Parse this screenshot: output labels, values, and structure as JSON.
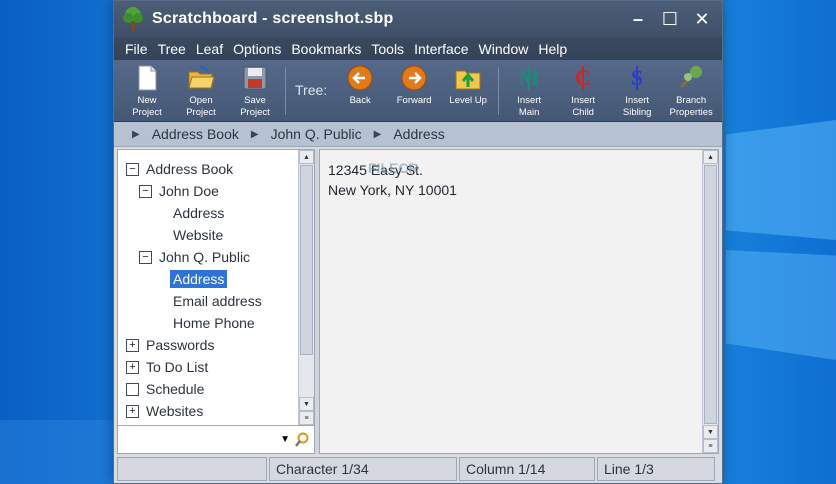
{
  "window": {
    "title": "Scratchboard - screenshot.sbp",
    "controls": {
      "minimize": "–",
      "maximize": "☐",
      "close": "✕"
    }
  },
  "menu": [
    "File",
    "Tree",
    "Leaf",
    "Options",
    "Bookmarks",
    "Tools",
    "Interface",
    "Window",
    "Help"
  ],
  "toolbar": {
    "new_project": "New\nProject",
    "open_project": "Open\nProject",
    "save_project": "Save\nProject",
    "tree_label": "Tree:",
    "back": "Back",
    "forward": "Forward",
    "level_up": "Level Up",
    "insert_main": "Insert\nMain",
    "insert_child": "Insert\nChild",
    "insert_sibling": "Insert\nSibling",
    "branch_properties": "Branch\nProperties"
  },
  "breadcrumb": [
    "Address Book",
    "John Q. Public",
    "Address"
  ],
  "tree": [
    {
      "label": "Address Book",
      "box": "−"
    },
    {
      "label": "John Doe",
      "box": "−"
    },
    {
      "label": "Address"
    },
    {
      "label": "Website"
    },
    {
      "label": "John Q. Public",
      "box": "−"
    },
    {
      "label": "Address",
      "selected": true
    },
    {
      "label": "Email address"
    },
    {
      "label": "Home Phone"
    },
    {
      "label": "Passwords",
      "box": "+"
    },
    {
      "label": "To Do List",
      "box": "+"
    },
    {
      "label": "Schedule",
      "box": ""
    },
    {
      "label": "Websites",
      "box": "+"
    }
  ],
  "content": {
    "line1": "12345 Easy St.",
    "line2": "New York, NY 10001",
    "watermark": "FILECR"
  },
  "status": {
    "character": "Character 1/34",
    "column": "Column 1/14",
    "line": "Line 1/3"
  },
  "colors": {
    "selection": "#2f73d9",
    "titlebar": "#4d5e78",
    "toolbar": "#56698a"
  }
}
